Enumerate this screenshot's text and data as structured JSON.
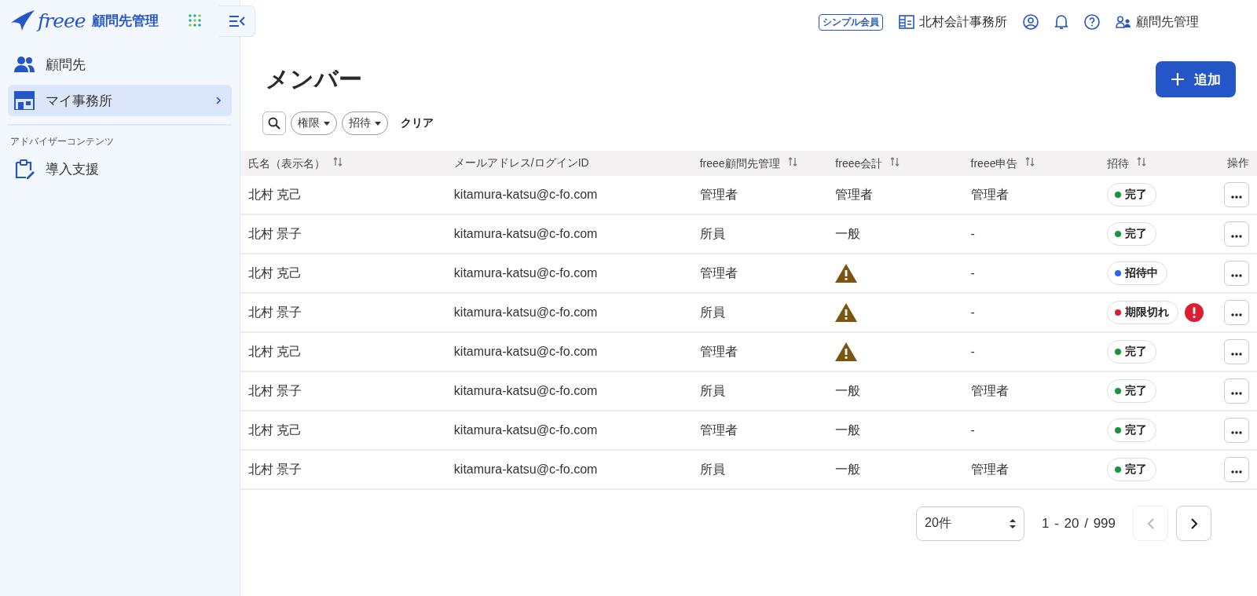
{
  "logo": {
    "wordmark": "freee",
    "product": "顧問先管理"
  },
  "sidebar": {
    "items": [
      {
        "label": "顧問先",
        "selected": false,
        "has_arrow": false
      },
      {
        "label": "マイ事務所",
        "selected": true,
        "has_arrow": true
      }
    ],
    "section_title": "アドバイザーコンテンツ",
    "section_items": [
      {
        "label": "導入支援",
        "selected": false,
        "has_arrow": false
      }
    ]
  },
  "header": {
    "plan_badge": "シンプル会員",
    "office": "北村会計事務所",
    "user": "顧問先管理"
  },
  "page": {
    "title": "メンバー",
    "add_button": "追加"
  },
  "filters": {
    "chips": [
      {
        "label": "権限"
      },
      {
        "label": "招待"
      }
    ],
    "clear": "クリア"
  },
  "table": {
    "columns": [
      {
        "label": "氏名（表示名）",
        "sortable": true
      },
      {
        "label": "メールアドレス/ログインID",
        "sortable": false
      },
      {
        "label": "freee顧問先管理",
        "sortable": true
      },
      {
        "label": "freee会計",
        "sortable": true
      },
      {
        "label": "freee申告",
        "sortable": true
      },
      {
        "label": "招待",
        "sortable": true
      },
      {
        "label": "操作",
        "sortable": false
      }
    ],
    "rows": [
      {
        "name": "北村 克己",
        "email": "kitamura-katsu@c-fo.com",
        "advisor": "管理者",
        "accounting": {
          "kind": "text",
          "text": "管理者"
        },
        "filing": "管理者",
        "invite": {
          "label": "完了",
          "color": "#14963c"
        },
        "alert": false
      },
      {
        "name": "北村 景子",
        "email": "kitamura-katsu@c-fo.com",
        "advisor": "所員",
        "accounting": {
          "kind": "text",
          "text": "一般"
        },
        "filing": "-",
        "invite": {
          "label": "完了",
          "color": "#14963c"
        },
        "alert": false
      },
      {
        "name": "北村 克己",
        "email": "kitamura-katsu@c-fo.com",
        "advisor": "管理者",
        "accounting": {
          "kind": "warning"
        },
        "filing": "-",
        "invite": {
          "label": "招待中",
          "color": "#2864f0"
        },
        "alert": false
      },
      {
        "name": "北村 景子",
        "email": "kitamura-katsu@c-fo.com",
        "advisor": "所員",
        "accounting": {
          "kind": "warning"
        },
        "filing": "-",
        "invite": {
          "label": "期限切れ",
          "color": "#dc1e32"
        },
        "alert": true
      },
      {
        "name": "北村 克己",
        "email": "kitamura-katsu@c-fo.com",
        "advisor": "管理者",
        "accounting": {
          "kind": "warning"
        },
        "filing": "-",
        "invite": {
          "label": "完了",
          "color": "#14963c"
        },
        "alert": false
      },
      {
        "name": "北村 景子",
        "email": "kitamura-katsu@c-fo.com",
        "advisor": "所員",
        "accounting": {
          "kind": "text",
          "text": "一般"
        },
        "filing": "管理者",
        "invite": {
          "label": "完了",
          "color": "#14963c"
        },
        "alert": false
      },
      {
        "name": "北村 克己",
        "email": "kitamura-katsu@c-fo.com",
        "advisor": "管理者",
        "accounting": {
          "kind": "text",
          "text": "一般"
        },
        "filing": "-",
        "invite": {
          "label": "完了",
          "color": "#14963c"
        },
        "alert": false
      },
      {
        "name": "北村 景子",
        "email": "kitamura-katsu@c-fo.com",
        "advisor": "所員",
        "accounting": {
          "kind": "text",
          "text": "一般"
        },
        "filing": "管理者",
        "invite": {
          "label": "完了",
          "color": "#14963c"
        },
        "alert": false
      }
    ]
  },
  "pagination": {
    "page_size": "20件",
    "range": "1 - 20 / 999",
    "prev_disabled": true,
    "next_disabled": false
  }
}
